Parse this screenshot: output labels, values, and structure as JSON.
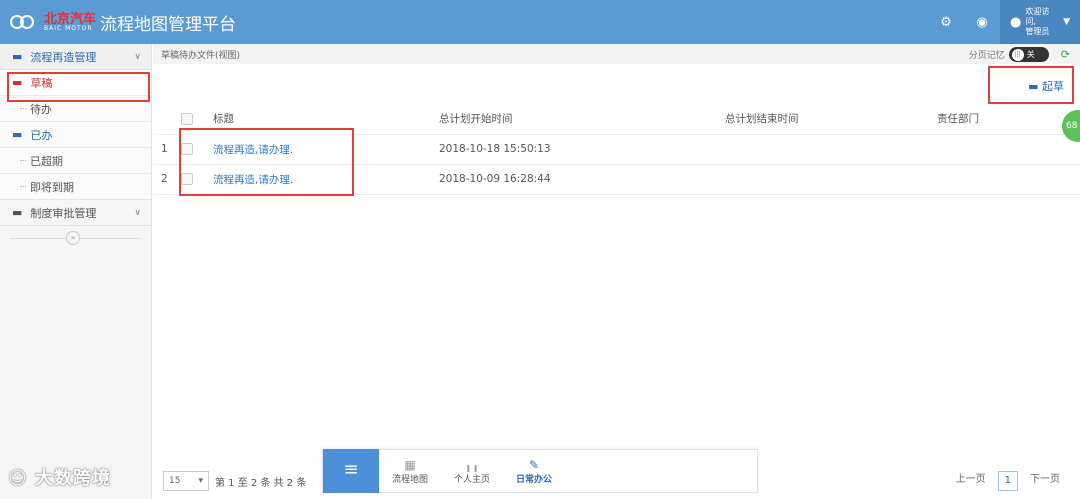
{
  "header": {
    "brand_cn": "北京汽车",
    "brand_en": "BAIC MOTOR",
    "title": "流程地图管理平台",
    "user_line1": "欢迎访问,",
    "user_line2": "管理员"
  },
  "sidebar": {
    "group1": "流程再造管理",
    "items": [
      {
        "label": "草稿"
      },
      {
        "label": "待办"
      },
      {
        "label": "已办"
      },
      {
        "label": "已超期"
      },
      {
        "label": "即将到期"
      }
    ],
    "group2": "制度审批管理"
  },
  "breadcrumb": "草稿待办文件(视图)",
  "page_memory": {
    "label": "分页记忆",
    "toggle": "关"
  },
  "toolbar": {
    "draft_label": "起草"
  },
  "table": {
    "headers": {
      "title": "标题",
      "start": "总计划开始时间",
      "end": "总计划结束时间",
      "dept": "责任部门"
    },
    "rows": [
      {
        "num": "1",
        "title": "流程再造,请办理.",
        "start": "2018-10-18 15:50:13",
        "end": "",
        "dept": ""
      },
      {
        "num": "2",
        "title": "流程再造,请办理.",
        "start": "2018-10-09 16:28:44",
        "end": "",
        "dept": ""
      }
    ]
  },
  "badge": "68",
  "pager": {
    "page_size": "15",
    "summary": "第 1 至 2 条 共 2 条",
    "prev": "上一页",
    "current": "1",
    "next": "下一页"
  },
  "dock": {
    "items": [
      {
        "label": "流程地图"
      },
      {
        "label": "个人主页"
      },
      {
        "label": "日常办公"
      }
    ]
  },
  "watermark": "大数跨境"
}
